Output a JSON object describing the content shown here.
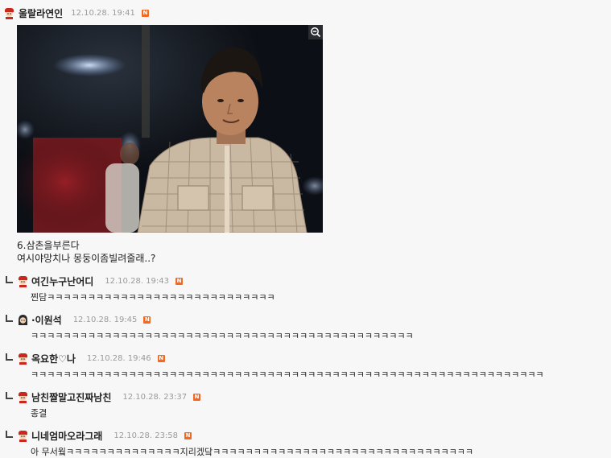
{
  "post": {
    "author": "울랄라연인",
    "time": "12.10.28. 19:41",
    "new_badge": "N",
    "line1": "6.삼촌을부른다",
    "line2": "여시야망치나 몽둥이좀빌려줄래..?"
  },
  "comments": [
    {
      "author": "여긴누구난어디",
      "time": "12.10.28. 19:43",
      "badge": "N",
      "text": "찐담ㅋㅋㅋㅋㅋㅋㅋㅋㅋㅋㅋㅋㅋㅋㅋㅋㅋㅋㅋㅋㅋㅋㅋㅋㅋㅋㅋㅋ"
    },
    {
      "author": "·이원석",
      "time": "12.10.28. 19:45",
      "badge": "N",
      "text": "ㅋㅋㅋㅋㅋㅋㅋㅋㅋㅋㅋㅋㅋㅋㅋㅋㅋㅋㅋㅋㅋㅋㅋㅋㅋㅋㅋㅋㅋㅋㅋㅋㅋㅋㅋㅋㅋㅋㅋㅋㅋㅋㅋㅋㅋㅋㅋ"
    },
    {
      "author": "옥요한♡나",
      "time": "12.10.28. 19:46",
      "badge": "N",
      "text": "ㅋㅋㅋㅋㅋㅋㅋㅋㅋㅋㅋㅋㅋㅋㅋㅋㅋㅋㅋㅋㅋㅋㅋㅋㅋㅋㅋㅋㅋㅋㅋㅋㅋㅋㅋㅋㅋㅋㅋㅋㅋㅋㅋㅋㅋㅋㅋㅋㅋㅋㅋㅋㅋㅋㅋㅋㅋㅋㅋㅋㅋㅋㅋ"
    },
    {
      "author": "남친짤말고진짜남친",
      "time": "12.10.28. 23:37",
      "badge": "N",
      "text": "종결"
    },
    {
      "author": "니네엄마오라그래",
      "time": "12.10.28. 23:58",
      "badge": "N",
      "text": "아 무서웤ㅋㅋㅋㅋㅋㅋㅋㅋㅋㅋㅋㅋㅋㅋ지리겠닼ㅋㅋㅋㅋㅋㅋㅋㅋㅋㅋㅋㅋㅋㅋㅋㅋㅋㅋㅋㅋㅋㅋㅋㅋㅋㅋㅋㅋㅋㅋㅋㅋ"
    }
  ],
  "icons": {
    "avatar": "avatar-icon",
    "reply": "reply-arrow-icon",
    "zoom": "zoom-out-icon",
    "new": "new-badge-icon"
  },
  "colors": {
    "background": "#f7f7f7",
    "badge": "#f26a21",
    "timestamp": "#9a9a9a"
  }
}
